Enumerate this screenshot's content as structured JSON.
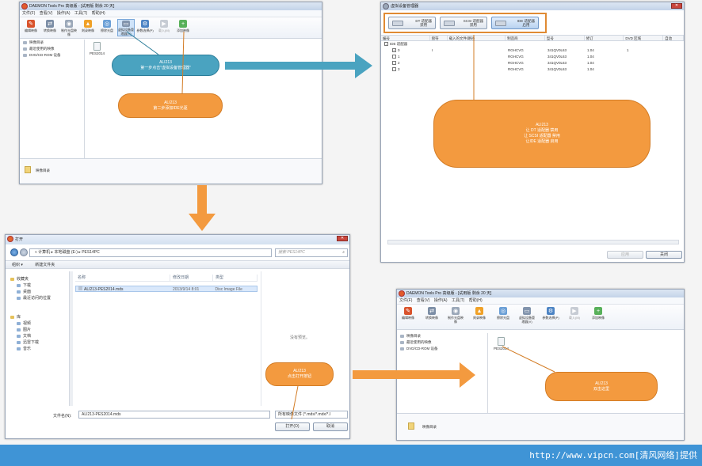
{
  "win1": {
    "title": "DAEMON Tools Pro 高级版 - [试用版 剩余 20 天]",
    "menu": [
      "文件(F)",
      "查看(V)",
      "操作(A)",
      "工具(T)",
      "帮助(H)"
    ],
    "tools": [
      "编辑映像",
      "转换映像",
      "制作光盘映像",
      "刻录映像",
      "擦除光盘",
      "虚拟设备管理器(V)",
      "参数选择(P)",
      "载入(M)",
      "添加映像"
    ],
    "side": [
      "映像目录",
      "最近使用的映像",
      "DVD/CD-ROM 设备"
    ],
    "disc": "PES2014",
    "bottom": "映像目录"
  },
  "callouts": {
    "c1": {
      "line1": "ALI213",
      "line2": "第一步点击\"虚拟设备管理器\""
    },
    "c2": {
      "line1": "ALI213",
      "line2": "第二步添加IDE光驱"
    },
    "c3": {
      "line1": "ALI213",
      "line2": "让 DT 适配器 禁用",
      "line3": "让 SCSI 适配器 禁用",
      "line4": "让IDE 适配器 启用"
    },
    "c4": {
      "line1": "ALI213",
      "line2": "点击打开按钮"
    },
    "c5": {
      "line1": "ALI213",
      "line2": "双击这里"
    }
  },
  "vdm": {
    "title": "虚拟设备管理器",
    "buttons": [
      {
        "label1": "DT 适配器",
        "label2": "禁用"
      },
      {
        "label1": "SCSI 适配器",
        "label2": "禁用"
      },
      {
        "label1": "IDE 适配器",
        "label2": "启用"
      }
    ],
    "columns": [
      "编号",
      "盘符",
      "载入的文件/路径",
      "制造商",
      "型号",
      "修订",
      "DVD 区域",
      "自动"
    ],
    "group": "IDE 适配器",
    "rows": [
      {
        "num": "0",
        "drive": "I",
        "path": "",
        "vendor": "RGHCVG",
        "model": "341QV0L63",
        "rev": "1.04",
        "region": "1"
      },
      {
        "num": "1",
        "drive": "",
        "path": "",
        "vendor": "RGHCVG",
        "model": "341QV0L63",
        "rev": "1.04",
        "region": ""
      },
      {
        "num": "2",
        "drive": "",
        "path": "",
        "vendor": "RGHCVG",
        "model": "341QV0L63",
        "rev": "1.04",
        "region": ""
      },
      {
        "num": "3",
        "drive": "",
        "path": "",
        "vendor": "RGHCVG",
        "model": "341QV0L63",
        "rev": "1.04",
        "region": ""
      }
    ],
    "apply": "应用",
    "close": "关闭"
  },
  "open": {
    "title": "打开",
    "path": "« 计算机 ▸ 本地磁盘 (E:) ▸ PES14PC",
    "search_placeholder": "搜索 PES14PC",
    "organize": "组织 ▾",
    "new_folder": "新建文件夹",
    "nav": [
      {
        "label": "收藏夹",
        "sub": false
      },
      {
        "label": "下载",
        "sub": true
      },
      {
        "label": "桌面",
        "sub": true
      },
      {
        "label": "最近访问的位置",
        "sub": true
      },
      {
        "label": "库",
        "sub": false
      },
      {
        "label": "视频",
        "sub": true
      },
      {
        "label": "图片",
        "sub": true
      },
      {
        "label": "文档",
        "sub": true
      },
      {
        "label": "迅雷下载",
        "sub": true
      },
      {
        "label": "音乐",
        "sub": true
      }
    ],
    "cols": [
      "名称",
      "修改日期",
      "类型"
    ],
    "file": {
      "name": "ALI213-PES2014.mds",
      "date": "2013/9/14 8:01",
      "type": "Disc Image File"
    },
    "preview": "没有预览。",
    "filename_label": "文件名(N):",
    "filename": "ALI213-PES2014.mds",
    "filter": "所有映像文件 (*.mds/*.mdx/*.I",
    "open_btn": "打开(O)",
    "cancel_btn": "取消"
  },
  "win2": {
    "title": "DAEMON Tools Pro 高级版 - [试用版 剩余 20 天]",
    "menu": [
      "文件(F)",
      "查看(V)",
      "操作(A)",
      "工具(T)",
      "帮助(H)"
    ],
    "tools": [
      "编辑映像",
      "转换映像",
      "制作光盘映像",
      "刻录映像",
      "擦除光盘",
      "虚拟设备管理器(V)",
      "参数选择(P)",
      "载入(M)",
      "添加映像"
    ],
    "side": [
      "映像目录",
      "最近使用的映像",
      "DVD/CD-ROM 设备"
    ],
    "disc": "PES2014",
    "bottom": "映像目录"
  },
  "colors": {
    "blue_callout": "#4aa3c0",
    "orange_callout": "#f39a3f",
    "footer": "#3f94d6"
  },
  "footer": "http://www.vipcn.com[清风网络]提供"
}
